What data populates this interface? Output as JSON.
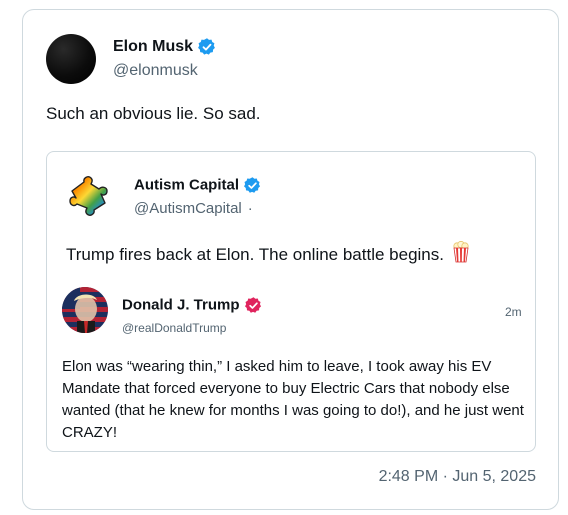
{
  "tweet": {
    "author_name": "Elon Musk",
    "author_handle": "@elonmusk",
    "text": "Such an obvious lie. So sad.",
    "timestamp": "2:48 PM · Jun 5, 2025",
    "verified_color": "#1d9bf0"
  },
  "quote": {
    "author_name": "Autism Capital",
    "author_handle": "@AutismCapital",
    "handle_separator": "·",
    "text": "Trump fires back at Elon. The online battle begins.",
    "emoji_icon": "popcorn-icon",
    "nested": {
      "author_name": "Donald J. Trump",
      "author_handle": "@realDonaldTrump",
      "time": "2m",
      "verified_color": "#e0245e",
      "text": "Elon was “wearing thin,” I asked him to leave, I took away his EV Mandate that forced everyone to buy Electric Cars that nobody else wanted (that he knew for months I was going to do!), and he just went CRAZY!"
    }
  }
}
